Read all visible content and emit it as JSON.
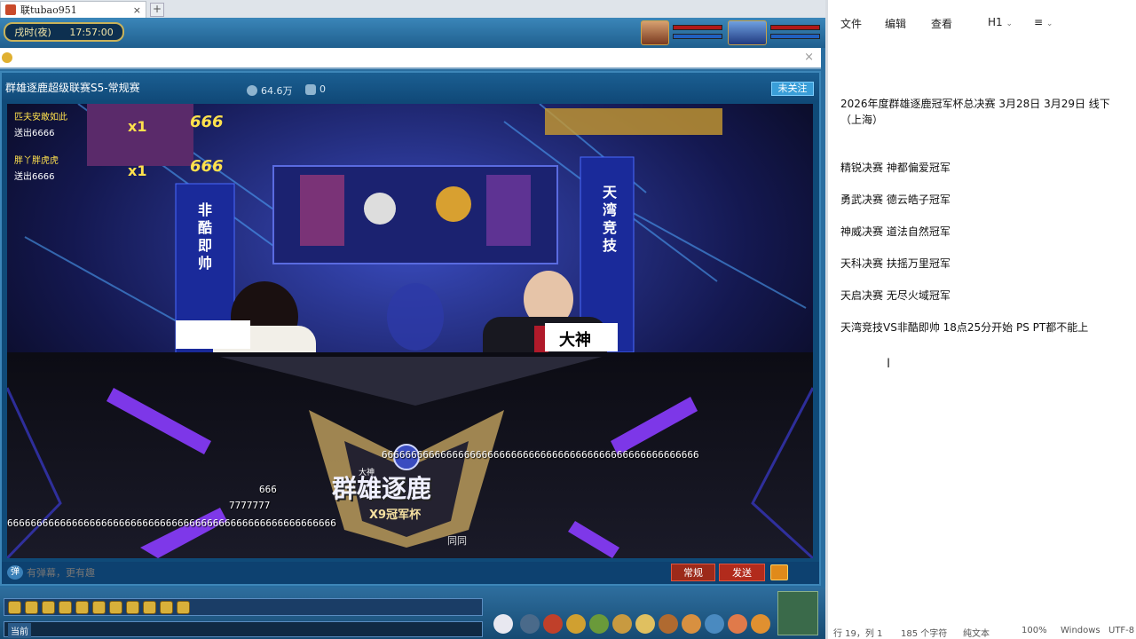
{
  "browser": {
    "tab_title": "联tubao951",
    "tab_close": "×",
    "new_tab": "+"
  },
  "game": {
    "time_period": "戌时(夜)",
    "time": "17:57:00"
  },
  "player": {
    "title": "群雄逐鹿超级联赛S5-常规赛",
    "popularity": "64.6万",
    "likes": "0",
    "follow_label": "未关注",
    "close": "×"
  },
  "stream": {
    "gifts": [
      {
        "name": "匹夫安敢如此",
        "action": "送出6666"
      },
      {
        "name": "胖丫胖虎虎",
        "action": "送出6666"
      }
    ],
    "gift_counts": [
      "x1",
      "x1"
    ],
    "gift_badges": [
      "666",
      "666"
    ],
    "banners": {
      "left_team": "非酷即帅",
      "right_team": "天湾竞技",
      "desk_sign": "大神",
      "logo_title": "群雄逐鹿",
      "logo_sub": "X9冠军杯",
      "logo_small": "大神",
      "watermark": "同同"
    },
    "danmu": [
      "666666666666666666666666666666666666666666666666666666",
      "666",
      "7777777",
      "66666666666666666666666666666666666666666666666666666666"
    ]
  },
  "input": {
    "dm_icon": "弹",
    "placeholder": "有弹幕，更有趣",
    "mode_label": "常规",
    "send_label": "发送"
  },
  "bottom": {
    "chat_channel": "当前"
  },
  "notepad": {
    "menu": [
      "文件",
      "编辑",
      "查看"
    ],
    "heading_label": "H1",
    "list_icon": "≡",
    "lines": [
      "2026年度群雄逐鹿冠军杯总决赛  3月28日  3月29日 线下",
      "（上海）",
      "",
      "精锐决赛  神都偏爱冠军",
      "",
      "勇武决赛  德云皓子冠军",
      "",
      "神威决赛  道法自然冠军",
      "",
      "天科决赛  扶摇万里冠军",
      "",
      "天启决赛  无尽火域冠军",
      "",
      "天湾竞技VS非酷即帅     18点25分开始    PS PT都不能上"
    ],
    "status": {
      "position": "行 19，列 1",
      "chars": "185 个字符",
      "format": "纯文本",
      "zoom": "100%",
      "eol": "Windows",
      "encoding": "UTF-8"
    }
  },
  "colors": {
    "game_blue": "#2a6ea0",
    "send_red": "#b22b1c",
    "stage_purple": "#8a3cff"
  }
}
